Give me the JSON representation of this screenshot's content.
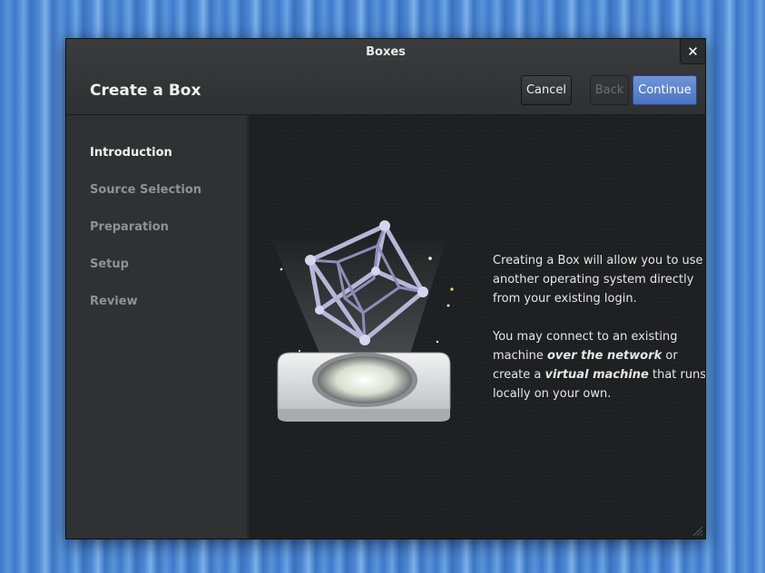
{
  "window": {
    "title": "Boxes",
    "close_glyph": "✕"
  },
  "header": {
    "heading": "Create a Box",
    "cancel_label": "Cancel",
    "back_label": "Back",
    "continue_label": "Continue"
  },
  "sidebar": {
    "steps": [
      {
        "label": "Introduction",
        "active": true
      },
      {
        "label": "Source Selection",
        "active": false
      },
      {
        "label": "Preparation",
        "active": false
      },
      {
        "label": "Setup",
        "active": false
      },
      {
        "label": "Review",
        "active": false
      }
    ]
  },
  "intro": {
    "paragraph1": "Creating a Box will allow you to use another operating system directly from your existing login.",
    "p2_part1": "You may connect to an existing machine ",
    "p2_em1": "over the network",
    "p2_part2": " or create a ",
    "p2_em2": "virtual machine",
    "p2_part3": " that runs locally on your own."
  },
  "icons": {
    "close": "close-icon",
    "illustration": "boxes-hypercube-illustration",
    "resize": "resize-grip-icon"
  },
  "colors": {
    "accent": "#4a73c2",
    "window_bg": "#2b2d2e",
    "content_bg": "#1e1f20",
    "desktop": "#3b76c4"
  }
}
